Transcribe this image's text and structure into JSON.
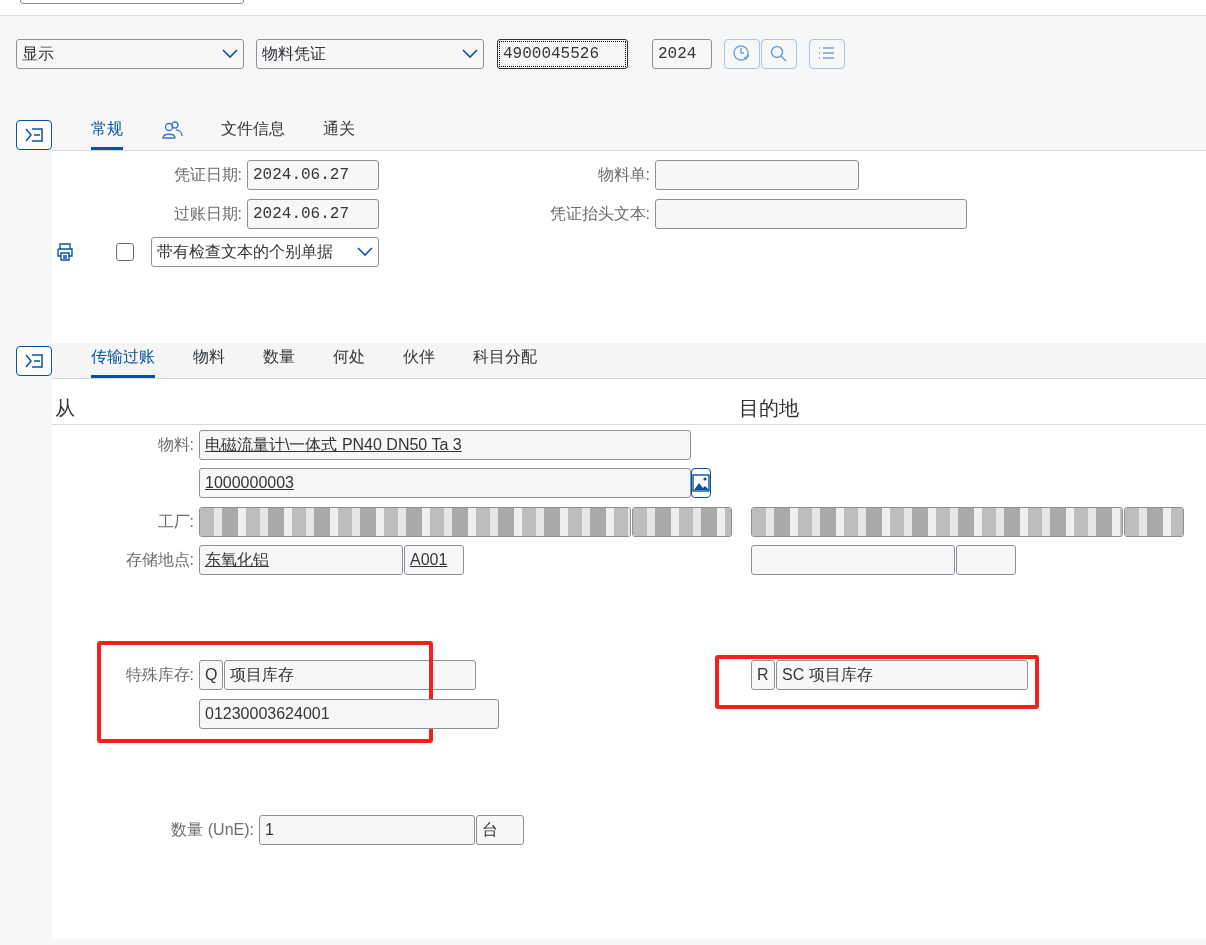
{
  "toolbar": {
    "action": {
      "value": "显示"
    },
    "object": {
      "value": "物料凭证"
    },
    "document": {
      "value": "4900045526",
      "focused": true
    },
    "year": {
      "value": "2024"
    }
  },
  "header_tabs": [
    {
      "kind": "text",
      "label": "常规",
      "selected": true
    },
    {
      "kind": "icon",
      "selected": false
    },
    {
      "kind": "text",
      "label": "文件信息",
      "selected": false
    },
    {
      "kind": "text",
      "label": "通关",
      "selected": false
    }
  ],
  "header": {
    "left": [
      {
        "label": "凭证日期:",
        "value": "2024.06.27"
      },
      {
        "label": "过账日期:",
        "value": "2024.06.27"
      }
    ],
    "right": [
      {
        "label": "物料单:"
      },
      {
        "label": "凭证抬头文本:"
      }
    ],
    "print": {
      "checked": false,
      "value": "带有检查文本的个别单据"
    }
  },
  "item_tabs": [
    {
      "label": "传输过账",
      "selected": true
    },
    {
      "label": "物料",
      "selected": false
    },
    {
      "label": "数量",
      "selected": false
    },
    {
      "label": "何处",
      "selected": false
    },
    {
      "label": "伙伴",
      "selected": false
    },
    {
      "label": "科目分配",
      "selected": false
    }
  ],
  "transfer": {
    "from_title": "从",
    "to_title": "目的地",
    "rows": [
      {
        "label": "物料:",
        "from": [
          {
            "value": "电磁流量计\\一体式 PN40 DN50 Ta 3",
            "link": true
          }
        ]
      },
      {
        "image_button": true,
        "from": [
          {
            "value": "1000000003",
            "link": true
          }
        ]
      },
      {
        "label": "工厂:",
        "from": [
          {
            "blurred": true
          },
          {
            "blurred": true
          }
        ],
        "to": [
          {
            "blurred": true
          },
          {
            "blurred": true
          }
        ]
      },
      {
        "label": "存储地点:",
        "from": [
          {
            "value": "东氧化铝",
            "link": true
          },
          {
            "value": "A001",
            "link": true
          }
        ],
        "to": [
          {
            "kind": "empty"
          },
          {
            "kind": "empty"
          }
        ]
      },
      {
        "label": "特殊库存:",
        "highlighted": true,
        "from": [
          {
            "value": "Q"
          },
          {
            "value": "项目库存"
          }
        ],
        "to": [
          {
            "value": "R"
          },
          {
            "value": "SC 项目库存"
          }
        ]
      },
      {
        "from": [
          {
            "value": "01230003624001"
          }
        ]
      },
      {
        "label": "数量 (UnE):",
        "from": [
          {
            "value": "1"
          },
          {
            "value": "台"
          }
        ]
      }
    ]
  }
}
